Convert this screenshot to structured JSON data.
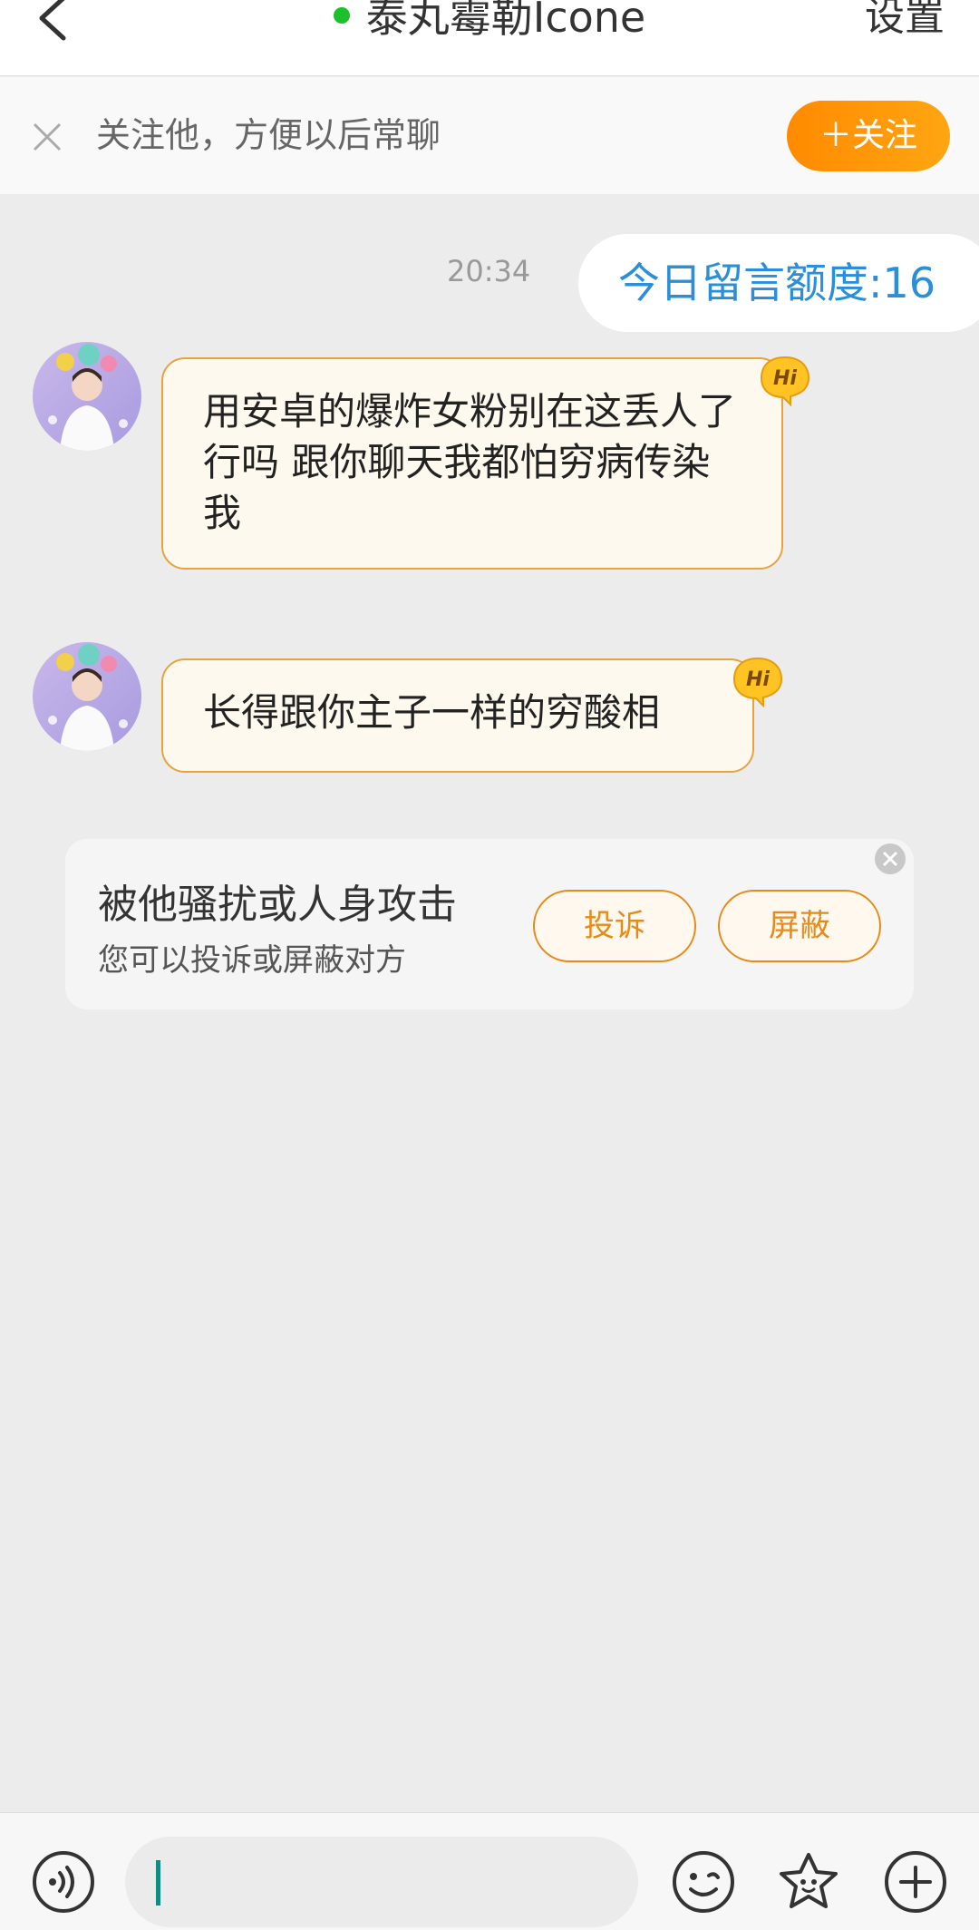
{
  "header": {
    "title": "泰丸霉勒Icone",
    "settings_label": "设置"
  },
  "follow_bar": {
    "text": "关注他，方便以后常聊",
    "button_label": "＋关注"
  },
  "chat": {
    "timestamp": "20:34",
    "quota_text": "今日留言额度:16",
    "messages": [
      {
        "text": "用安卓的爆炸女粉别在这丢人了行吗 跟你聊天我都怕穷病传染我",
        "badge": "Hi"
      },
      {
        "text": "长得跟你主子一样的穷酸相",
        "badge": "Hi"
      }
    ]
  },
  "report_card": {
    "title": "被他骚扰或人身攻击",
    "subtitle": "您可以投诉或屏蔽对方",
    "complain_label": "投诉",
    "block_label": "屏蔽"
  },
  "input_bar": {
    "icons": [
      "voice-icon",
      "emoji-icon",
      "sticker-icon",
      "plus-icon"
    ]
  },
  "colors": {
    "accent_orange": "#ff8a00",
    "quota_blue": "#2a8fd8",
    "bubble_border": "#e8a33c",
    "online_green": "#1cc02a"
  }
}
